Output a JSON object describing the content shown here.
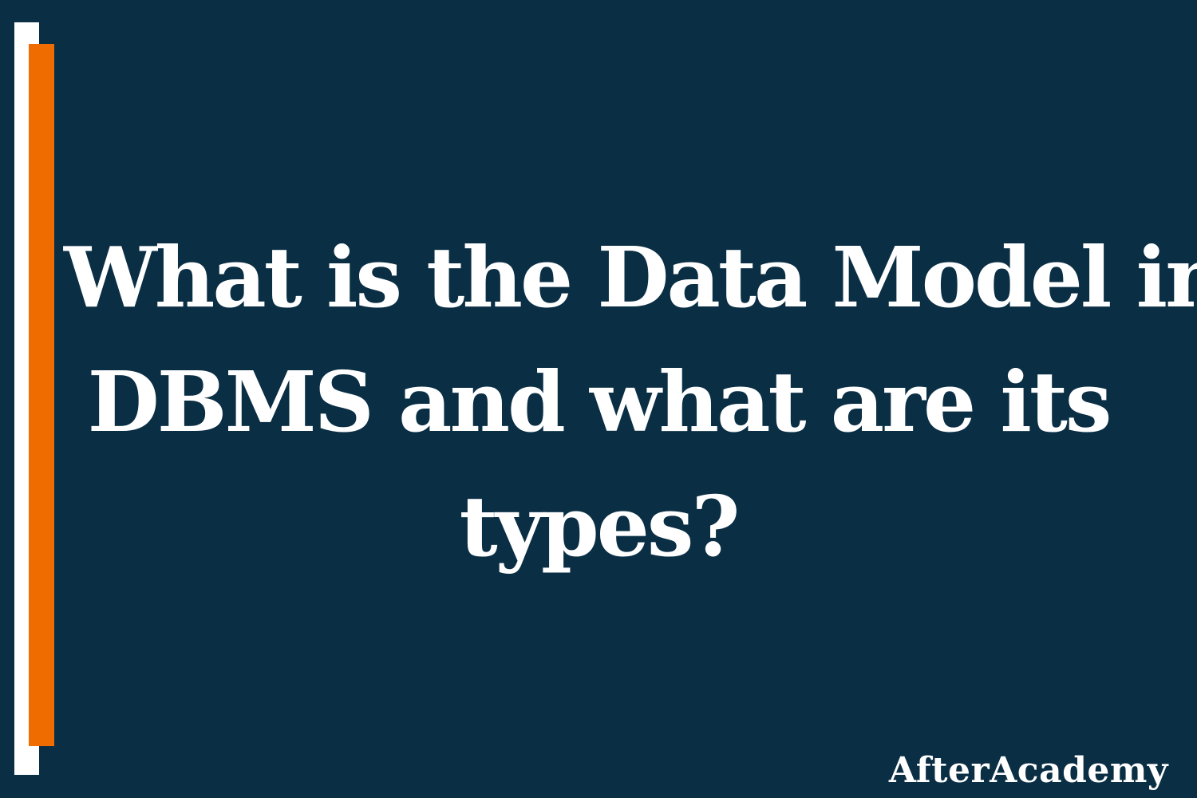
{
  "headline": {
    "line1": "What is the Data Model in",
    "line2": "DBMS and what are its",
    "line3": "types?"
  },
  "brand": {
    "name": "AfterAcademy"
  },
  "colors": {
    "background": "#0a2e44",
    "accent_orange": "#ef6c00",
    "accent_white": "#ffffff",
    "text": "#ffffff"
  }
}
